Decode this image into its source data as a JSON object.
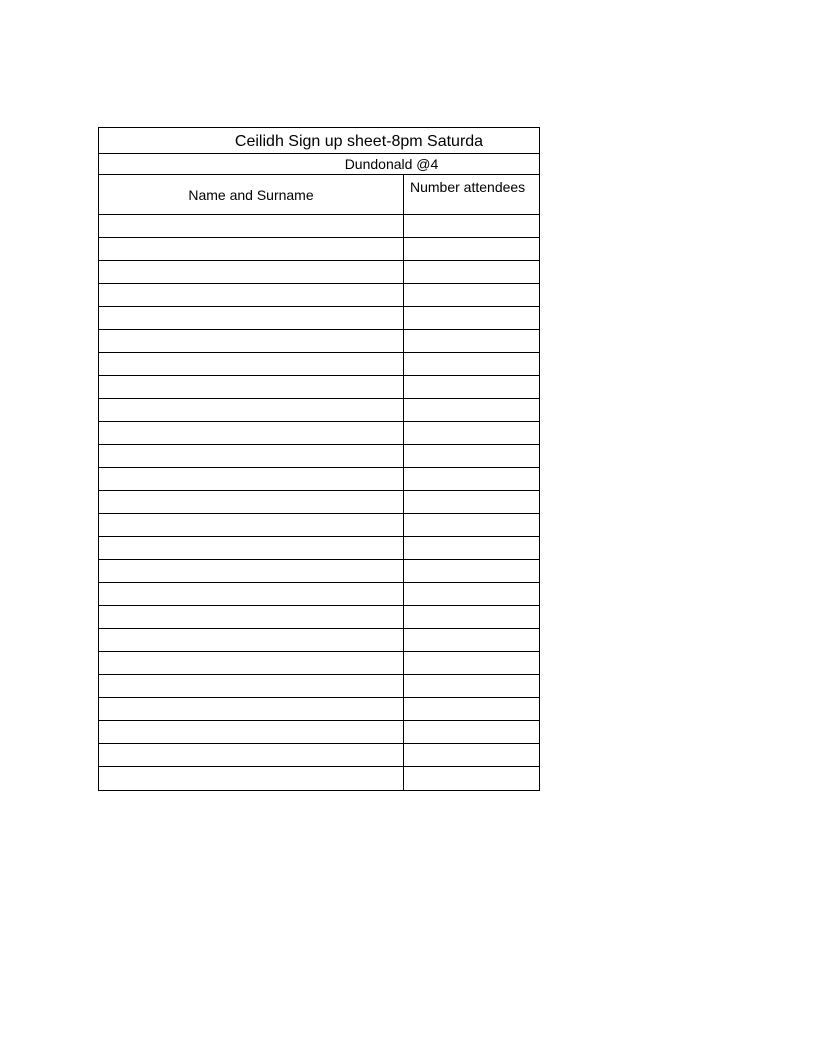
{
  "title": "Ceilidh Sign up sheet-8pm Saturda",
  "subtitle": "Dundonald @4",
  "columns": {
    "name": "Name and Surname",
    "attendees": "Number attendees"
  },
  "rowCount": 25,
  "rows": [
    {
      "name": "",
      "attendees": ""
    },
    {
      "name": "",
      "attendees": ""
    },
    {
      "name": "",
      "attendees": ""
    },
    {
      "name": "",
      "attendees": ""
    },
    {
      "name": "",
      "attendees": ""
    },
    {
      "name": "",
      "attendees": ""
    },
    {
      "name": "",
      "attendees": ""
    },
    {
      "name": "",
      "attendees": ""
    },
    {
      "name": "",
      "attendees": ""
    },
    {
      "name": "",
      "attendees": ""
    },
    {
      "name": "",
      "attendees": ""
    },
    {
      "name": "",
      "attendees": ""
    },
    {
      "name": "",
      "attendees": ""
    },
    {
      "name": "",
      "attendees": ""
    },
    {
      "name": "",
      "attendees": ""
    },
    {
      "name": "",
      "attendees": ""
    },
    {
      "name": "",
      "attendees": ""
    },
    {
      "name": "",
      "attendees": ""
    },
    {
      "name": "",
      "attendees": ""
    },
    {
      "name": "",
      "attendees": ""
    },
    {
      "name": "",
      "attendees": ""
    },
    {
      "name": "",
      "attendees": ""
    },
    {
      "name": "",
      "attendees": ""
    },
    {
      "name": "",
      "attendees": ""
    },
    {
      "name": "",
      "attendees": ""
    }
  ]
}
